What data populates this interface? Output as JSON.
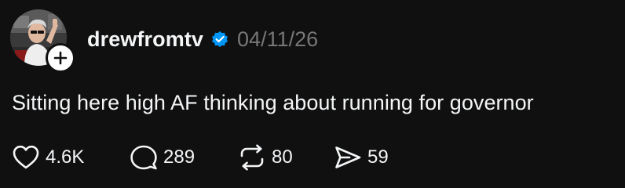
{
  "post": {
    "username": "drewfromtv",
    "verified": true,
    "timestamp": "04/11/26",
    "text": "Sitting here high AF thinking about running for governor",
    "actions": {
      "like_count": "4.6K",
      "reply_count": "289",
      "repost_count": "80",
      "share_count": "59"
    }
  },
  "icons": {
    "avatar": "avatar",
    "follow": "plus-icon",
    "verified": "verified-badge-icon",
    "like": "heart-icon",
    "reply": "comment-bubble-icon",
    "repost": "repost-icon",
    "share": "paper-plane-icon"
  },
  "colors": {
    "background": "#101010",
    "text": "#f3f5f7",
    "muted": "#777777",
    "verified": "#0095f6"
  }
}
